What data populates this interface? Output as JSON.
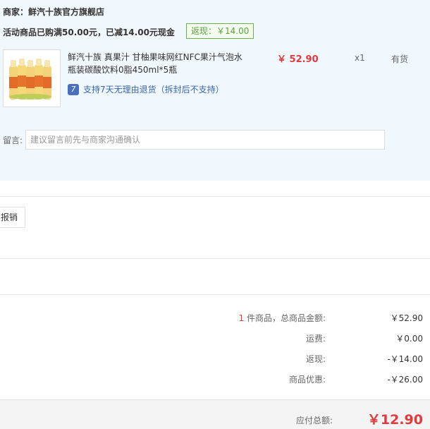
{
  "merchant": {
    "label": "商家：",
    "name": "鲜汽十族官方旗舰店"
  },
  "promo": {
    "text": "活动商品已购满50.00元，已减14.00元现金",
    "rebate_tag": "返现：￥14.00"
  },
  "product": {
    "title": "鲜汽十族 真果汁 甘柚果味网红NFC果汁气泡水 瓶装碳酸饮料0脂450ml*5瓶",
    "service": "支持7天无理由退货（拆封后不支持）",
    "service_icon": "7",
    "price": "￥ 52.90",
    "quantity": "x1",
    "stock": "有货"
  },
  "message": {
    "label": "留言:",
    "placeholder": "建议留言前先与商家沟通确认"
  },
  "invoice": {
    "button_label": "报销"
  },
  "summary": {
    "count": "1",
    "count_label": " 件商品，总商品金额:",
    "goods_total": "￥52.90",
    "shipping_label": "运费:",
    "shipping": "￥0.00",
    "rebate_label": "返现:",
    "rebate": "-￥14.00",
    "discount_label": "商品优惠:",
    "discount": "-￥26.00"
  },
  "total": {
    "label": "应付总额:",
    "value": "￥12.90"
  },
  "colors": {
    "accent_red": "#e4393c",
    "panel_bg": "#f0f7fd",
    "rebate_green": "#5aa03c",
    "link_blue": "#3a66b0"
  }
}
